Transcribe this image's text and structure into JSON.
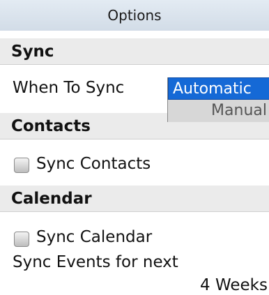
{
  "title": "Options",
  "sync_section": {
    "header": "Sync",
    "when_to_sync_label": "When To Sync",
    "options": [
      "Automatic",
      "Manual"
    ],
    "selected": "Automatic"
  },
  "contacts_section": {
    "header": "Contacts",
    "checkbox_label": "Sync Contacts",
    "checked": false
  },
  "calendar_section": {
    "header": "Calendar",
    "checkbox_label": "Sync Calendar",
    "checked": false,
    "events_label": "Sync Events for next",
    "events_value": "4 Weeks"
  }
}
